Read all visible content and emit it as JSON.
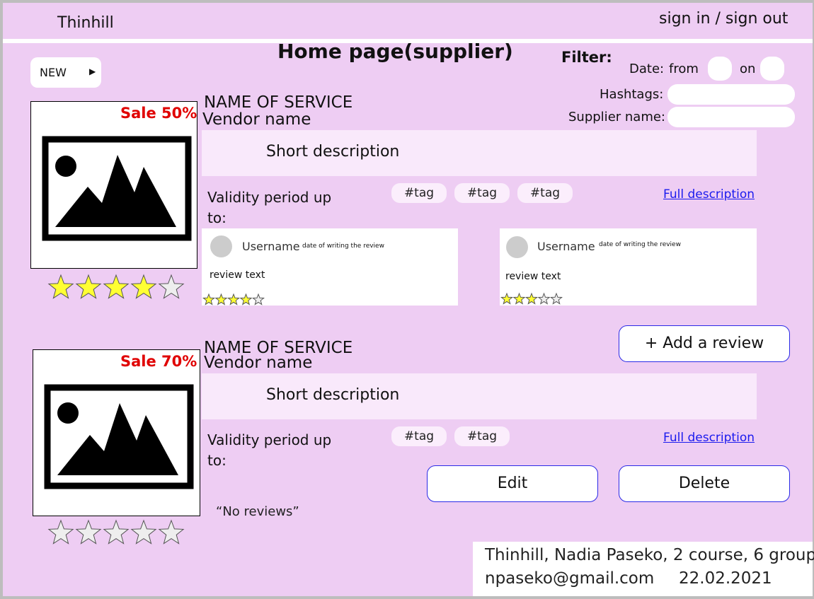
{
  "header": {
    "logo": "Thinhill",
    "auth_link": "sign in / sign out"
  },
  "page_title": "Home page(supplier)",
  "new_button": {
    "label": "NEW",
    "arrow": "▶"
  },
  "filter": {
    "title": "Filter:",
    "date_label": "Date:",
    "from_label": "from",
    "on_label": "on",
    "hashtags_label": "Hashtags:",
    "supplier_label": "Supplier name:"
  },
  "services": [
    {
      "sale": "Sale 50%",
      "name": "NAME OF SERVICE",
      "vendor": "Vendor name",
      "short_description": "Short description",
      "validity_line1": "Validity period up",
      "validity_line2": "to:",
      "tags": [
        "#tag",
        "#tag",
        "#tag"
      ],
      "full_description": "Full description",
      "rating": 4,
      "reviews": [
        {
          "username": "Username",
          "date": "date of writing the review",
          "text": "review text",
          "rating": 4
        },
        {
          "username": "Username",
          "date": "date of writing the review",
          "text": "review text",
          "rating": 3
        }
      ]
    },
    {
      "sale": "Sale 70%",
      "name": "NAME OF SERVICE",
      "vendor": "Vendor name",
      "short_description": "Short description",
      "validity_line1": "Validity period up",
      "validity_line2": "to:",
      "tags": [
        "#tag",
        "#tag"
      ],
      "full_description": "Full description",
      "rating": 0,
      "no_reviews": "“No reviews”"
    }
  ],
  "buttons": {
    "add_review": "+ Add a review",
    "edit": "Edit",
    "delete": "Delete"
  },
  "footer": {
    "line1": "Thinhill, Nadia Paseko, 2 course, 6 group",
    "email": "npaseko@gmail.com",
    "date": "22.02.2021"
  },
  "colors": {
    "background": "#eecdf3",
    "sale": "#e00000",
    "link": "#1a1aee",
    "star_fill": "#ffff33",
    "star_empty": "#eeeeee"
  }
}
